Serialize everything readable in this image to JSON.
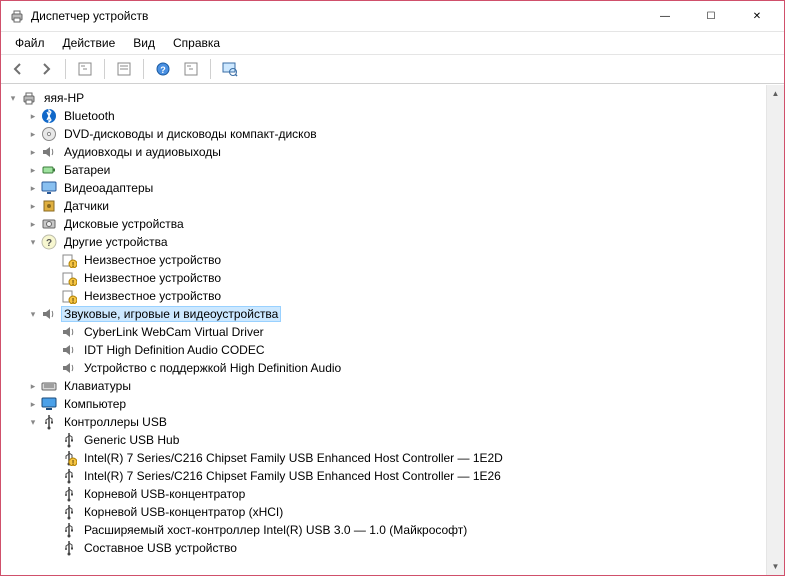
{
  "title": "Диспетчер устройств",
  "menu": {
    "file": "Файл",
    "action": "Действие",
    "view": "Вид",
    "help": "Справка"
  },
  "caption": {
    "min": "—",
    "max": "☐",
    "close": "✕"
  },
  "tree": {
    "root": "яяя-HP",
    "bluetooth": "Bluetooth",
    "dvd": "DVD-дисководы и дисководы компакт-дисков",
    "audio_io": "Аудиовходы и аудиовыходы",
    "batteries": "Батареи",
    "video_adapters": "Видеоадаптеры",
    "sensors": "Датчики",
    "disk_drives": "Дисковые устройства",
    "other_devices": "Другие устройства",
    "unknown_device": "Неизвестное устройство",
    "sound_video_game": "Звуковые, игровые и видеоустройства",
    "svg_child1": "CyberLink WebCam Virtual Driver",
    "svg_child2": "IDT High Definition Audio CODEC",
    "svg_child3": "Устройство с поддержкой High Definition Audio",
    "keyboards": "Клавиатуры",
    "computer": "Компьютер",
    "usb_controllers": "Контроллеры USB",
    "usb1": "Generic USB Hub",
    "usb2": "Intel(R) 7 Series/C216 Chipset Family USB Enhanced Host Controller — 1E2D",
    "usb3": "Intel(R) 7 Series/C216 Chipset Family USB Enhanced Host Controller — 1E26",
    "usb4": "Корневой USB-концентратор",
    "usb5": "Корневой USB-концентратор (xHCI)",
    "usb6": "Расширяемый хост-контроллер Intel(R) USB 3.0 — 1.0 (Майкрософт)",
    "usb7": "Составное USB устройство"
  }
}
